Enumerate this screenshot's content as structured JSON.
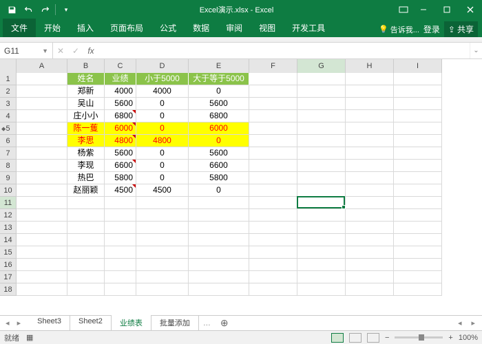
{
  "title": "Excel演示.xlsx - Excel",
  "tabs": {
    "file": "文件",
    "items": [
      "开始",
      "插入",
      "页面布局",
      "公式",
      "数据",
      "审阅",
      "视图",
      "开发工具"
    ],
    "tell_me": "告诉我...",
    "sign_in": "登录",
    "share": "共享"
  },
  "name_box": "G11",
  "columns": [
    {
      "l": "A",
      "w": 74
    },
    {
      "l": "B",
      "w": 54
    },
    {
      "l": "C",
      "w": 46
    },
    {
      "l": "D",
      "w": 76
    },
    {
      "l": "E",
      "w": 88
    },
    {
      "l": "F",
      "w": 70
    },
    {
      "l": "G",
      "w": 70
    },
    {
      "l": "H",
      "w": 70
    },
    {
      "l": "I",
      "w": 70
    }
  ],
  "selected_col_index": 6,
  "selected_row_index": 10,
  "headers": [
    "姓名",
    "业绩",
    "小于5000",
    "大于等于5000"
  ],
  "rows": [
    {
      "name": "郑新",
      "score": 4000,
      "lt": 4000,
      "ge": 0,
      "hl": false,
      "tri": false
    },
    {
      "name": "吴山",
      "score": 5600,
      "lt": 0,
      "ge": 5600,
      "hl": false,
      "tri": false
    },
    {
      "name": "庄小小",
      "score": 6800,
      "lt": 0,
      "ge": 6800,
      "hl": false,
      "tri": true
    },
    {
      "name": "陈一蒦",
      "score": 6000,
      "lt": 0,
      "ge": 6000,
      "hl": true,
      "tri": true
    },
    {
      "name": "李思",
      "score": 4800,
      "lt": 4800,
      "ge": 0,
      "hl": true,
      "tri": true
    },
    {
      "name": "杨紫",
      "score": 5600,
      "lt": 0,
      "ge": 5600,
      "hl": false,
      "tri": false
    },
    {
      "name": "李现",
      "score": 6600,
      "lt": 0,
      "ge": 6600,
      "hl": false,
      "tri": true
    },
    {
      "name": "热巴",
      "score": 5800,
      "lt": 0,
      "ge": 5800,
      "hl": false,
      "tri": false
    },
    {
      "name": "赵丽颖",
      "score": 4500,
      "lt": 4500,
      "ge": 0,
      "hl": false,
      "tri": true
    }
  ],
  "total_visible_rows": 18,
  "sheet_tabs": [
    "Sheet3",
    "Sheet2",
    "业绩表",
    "批量添加"
  ],
  "active_sheet_index": 2,
  "status": {
    "ready": "就绪",
    "zoom": "100%"
  },
  "active_cell": {
    "col": 6,
    "row": 10
  }
}
